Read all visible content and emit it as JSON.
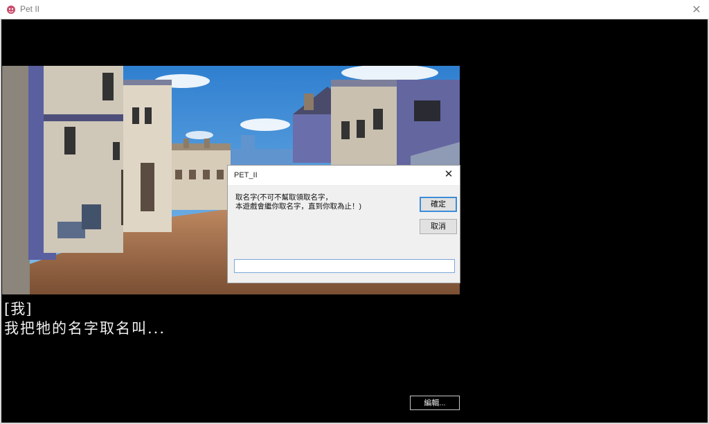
{
  "window": {
    "title": "Pet II",
    "close_glyph": "✕"
  },
  "dialogue": {
    "speaker": "[我]",
    "line": "我把牠的名字取名叫..."
  },
  "edit_button": {
    "label": "編輯..."
  },
  "dialog": {
    "title": "PET_II",
    "close_glyph": "✕",
    "prompt_line1": "取名字(不可不幫取領取名字，",
    "prompt_line2": "本遊戲會繼你取名字，直到你取為止！)",
    "ok_label": "確定",
    "cancel_label": "取消",
    "input_value": ""
  },
  "icons": {
    "app": "pet-app-icon",
    "window_close": "close-icon",
    "dialog_close": "close-icon"
  },
  "colors": {
    "focus_accent": "#3c8dd8",
    "dialog_bg": "#f0f0f0",
    "game_bg": "#000000"
  }
}
